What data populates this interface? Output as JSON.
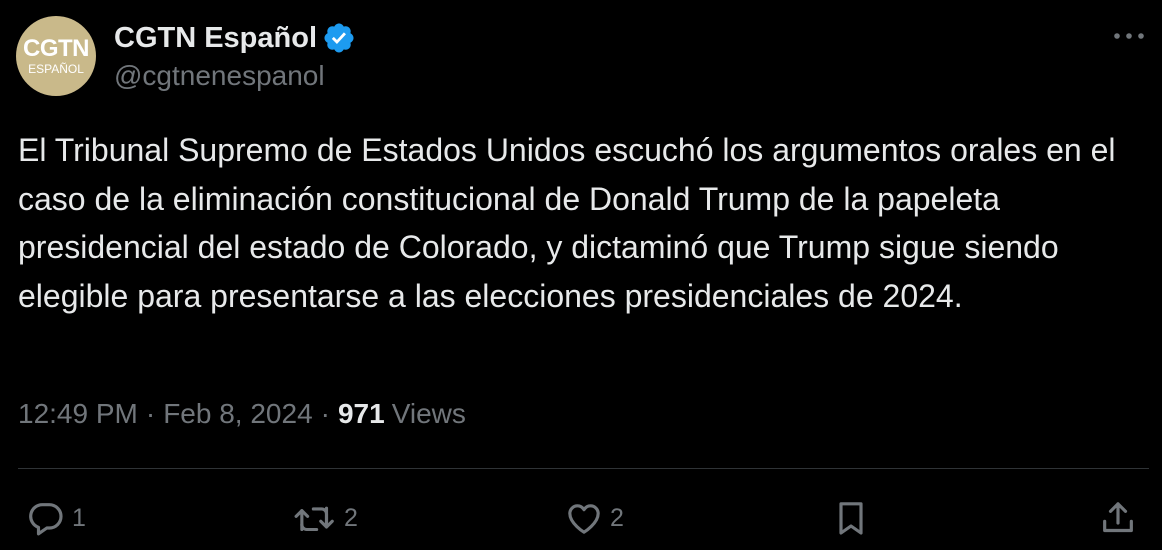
{
  "author": {
    "display_name": "CGTN Español",
    "handle": "@cgtnenespanol",
    "avatar_text_top": "CGTN",
    "avatar_text_bottom": "ESPAÑOL",
    "avatar_color": "#c9b98a",
    "verified_icon": "verified-badge-icon",
    "verified_color": "#1d9bf0"
  },
  "tweet": {
    "text": "El Tribunal Supremo de Estados Unidos escuchó los argumentos orales en el caso de la eliminación constitucional de Donald Trump de la papeleta presidencial del estado de Colorado, y dictaminó que Trump sigue siendo elegible para presentarse a las elecciones presidenciales de 2024.",
    "time": "12:49 PM",
    "separator": "·",
    "date": "Feb 8, 2024",
    "views_count": "971",
    "views_label": "Views"
  },
  "actions": {
    "reply": {
      "icon": "reply-icon",
      "count": "1"
    },
    "retweet": {
      "icon": "retweet-icon",
      "count": "2"
    },
    "like": {
      "icon": "heart-icon",
      "count": "2"
    },
    "bookmark": {
      "icon": "bookmark-icon"
    },
    "share": {
      "icon": "share-icon"
    }
  },
  "colors": {
    "background": "#000000",
    "text_primary": "#e7e9ea",
    "text_secondary": "#71767b",
    "divider": "#2f3336"
  }
}
